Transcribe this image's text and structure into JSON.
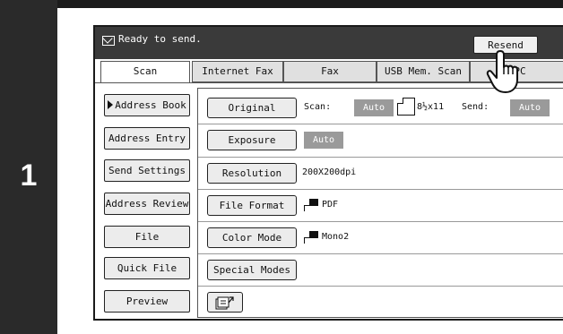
{
  "step": {
    "number": "1"
  },
  "status": {
    "text": "Ready to send.",
    "resend_label": "Resend"
  },
  "tabs": [
    {
      "label": "Scan",
      "active": true
    },
    {
      "label": "Internet Fax"
    },
    {
      "label": "Fax"
    },
    {
      "label": "USB Mem. Scan"
    },
    {
      "label": "PC"
    }
  ],
  "sidebar": {
    "items": [
      {
        "label": "Address Book"
      },
      {
        "label": "Address Entry"
      },
      {
        "label": "Send Settings"
      },
      {
        "label": "Address Review"
      },
      {
        "label": "File"
      },
      {
        "label": "Quick File"
      },
      {
        "label": "Preview"
      }
    ]
  },
  "settings": {
    "original_label": "Original",
    "scan_label": "Scan:",
    "scan_value": "Auto",
    "paper_size": "8½x11",
    "send_label": "Send:",
    "send_value": "Auto",
    "exposure_label": "Exposure",
    "exposure_value": "Auto",
    "resolution_label": "Resolution",
    "resolution_value": "200X200dpi",
    "file_format_label": "File Format",
    "file_format_value": "PDF",
    "color_mode_label": "Color Mode",
    "color_mode_value": "Mono2",
    "special_modes_label": "Special Modes"
  },
  "icons": {
    "status": "envelope-icon",
    "paper": "paper-sheet-icon",
    "format": "document-format-icon",
    "color": "color-mode-icon",
    "program": "program-registration-icon",
    "pointer": "hand-pointer-icon"
  }
}
